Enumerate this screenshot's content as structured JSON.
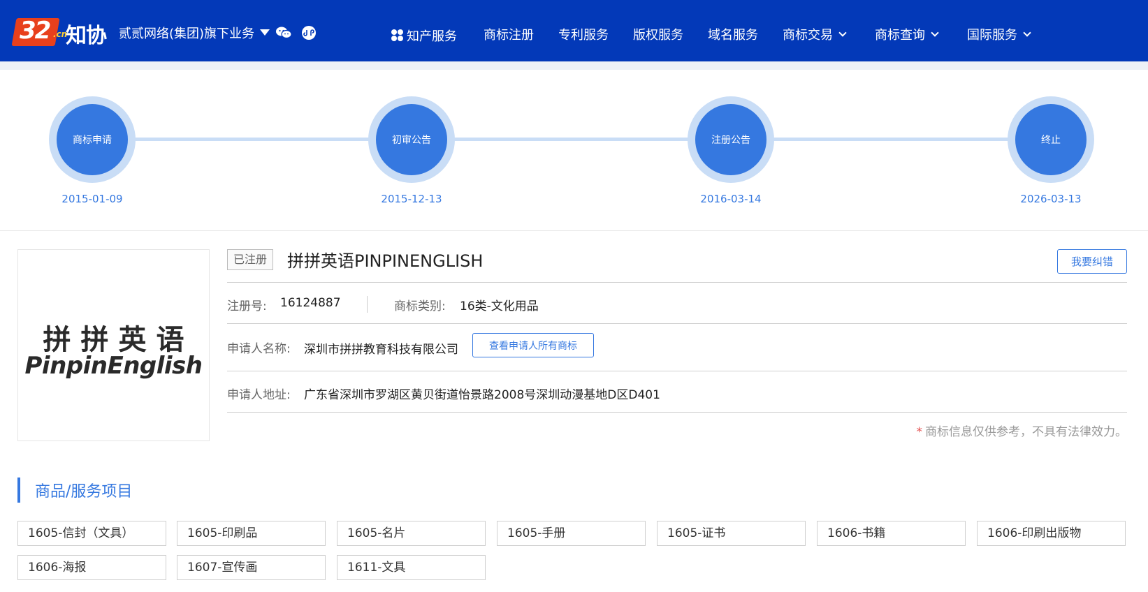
{
  "header": {
    "logo_text": "32.cn 知协",
    "logo_num": "32",
    "logo_cn": ".cn",
    "logo_name": "知协",
    "group_label": "贰贰网络(集团)旗下业务",
    "nav": [
      {
        "label": "知产服务",
        "dropdown": false
      },
      {
        "label": "商标注册",
        "dropdown": false
      },
      {
        "label": "专利服务",
        "dropdown": false
      },
      {
        "label": "版权服务",
        "dropdown": false
      },
      {
        "label": "域名服务",
        "dropdown": false
      },
      {
        "label": "商标交易",
        "dropdown": true
      },
      {
        "label": "商标查询",
        "dropdown": true
      },
      {
        "label": "国际服务",
        "dropdown": true
      }
    ],
    "colors": {
      "bar": "#0339b8",
      "accent": "#3578e0"
    }
  },
  "timeline": [
    {
      "label": "商标申请",
      "date": "2015-01-09"
    },
    {
      "label": "初审公告",
      "date": "2015-12-13"
    },
    {
      "label": "注册公告",
      "date": "2016-03-14"
    },
    {
      "label": "终止",
      "date": "2026-03-13"
    }
  ],
  "trademark": {
    "image_cn": "拼拼英语",
    "image_en": "PinpinEnglish",
    "status": "已注册",
    "name": "拼拼英语PINPINENGLISH",
    "report_button": "我要纠错",
    "reg_no_label": "注册号:",
    "reg_no": "16124887",
    "class_label": "商标类别:",
    "class_value": "16类-文化用品",
    "applicant_label": "申请人名称:",
    "applicant": "深圳市拼拼教育科技有限公司",
    "applicant_button": "查看申请人所有商标",
    "address_label": "申请人地址:",
    "address": "广东省深圳市罗湖区黄贝街道怡景路2008号深圳动漫基地D区D401",
    "note": "商标信息仅供参考，不具有法律效力。",
    "note_star": "*"
  },
  "goods": {
    "title": "商品/服务项目",
    "items": [
      "1605-信封（文具）",
      "1605-印刷品",
      "1605-名片",
      "1605-手册",
      "1605-证书",
      "1606-书籍",
      "1606-印刷出版物",
      "1606-海报",
      "1607-宣传画",
      "1611-文具"
    ]
  }
}
